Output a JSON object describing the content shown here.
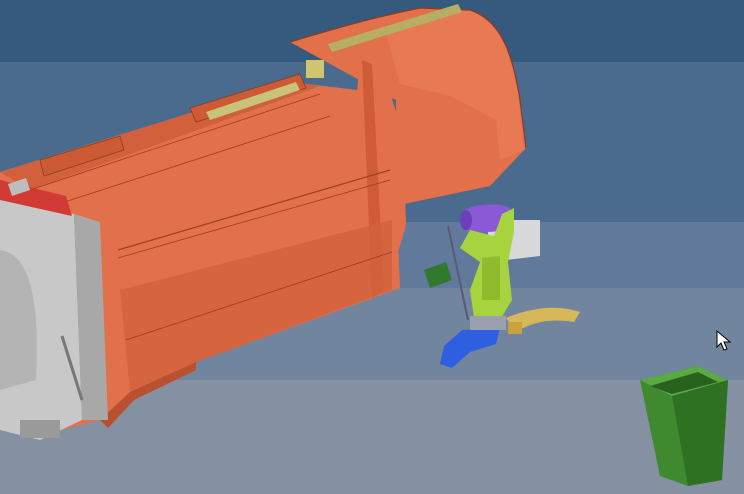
{
  "viewport": {
    "background_bands": [
      "#365a7e",
      "#4a6a8e",
      "#61799a",
      "#71859f",
      "#8590a2"
    ]
  },
  "scene": {
    "objects": [
      {
        "name": "garbage-truck-body",
        "color": "#e2704a"
      },
      {
        "name": "hopper-opening",
        "color": "#4f9ed4"
      },
      {
        "name": "tailgate-frame",
        "color": "#c8c8c8"
      },
      {
        "name": "packing-cylinder-left",
        "color": "#c9c27a"
      },
      {
        "name": "packing-cylinder-top",
        "color": "#b7ad63"
      },
      {
        "name": "lift-arm-hydraulic-block",
        "color": "#8a59d6"
      },
      {
        "name": "lifter-arm",
        "color": "#a6d33e"
      },
      {
        "name": "lifter-hook",
        "color": "#d6b85a"
      },
      {
        "name": "lifter-gripper",
        "color": "#2e5fe0"
      },
      {
        "name": "mount-plate",
        "color": "#d8d8d8"
      },
      {
        "name": "waste-bin",
        "color": "#3f8a2e"
      }
    ]
  },
  "cursor": {
    "icon": "arrow-cursor-icon"
  }
}
